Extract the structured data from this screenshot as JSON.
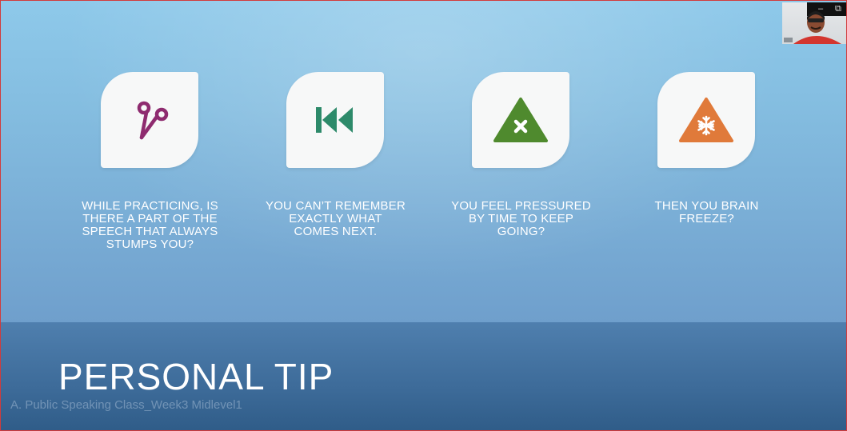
{
  "slide": {
    "title": "PERSONAL TIP",
    "watermark": "A. Public Speaking Class_Week3 Midlevel1"
  },
  "tips": [
    {
      "icon": "scissors-icon",
      "icon_color": "#8e2b6f",
      "text": "WHILE PRACTICING, IS\nTHERE A PART OF THE\nSPEECH THAT ALWAYS\nSTUMPS YOU?"
    },
    {
      "icon": "rewind-icon",
      "icon_color": "#2d8a6a",
      "text": "YOU CAN’T REMEMBER\nEXACTLY WHAT\nCOMES NEXT."
    },
    {
      "icon": "warning-x-icon",
      "icon_color": "#4f8a2e",
      "text": "YOU FEEL PRESSURED\nBY TIME TO KEEP\nGOING?"
    },
    {
      "icon": "warning-snowflake-icon",
      "icon_color": "#e07a3a",
      "text": "THEN YOU BRAIN\nFREEZE?"
    }
  ],
  "video_window": {
    "minimize_label": "–",
    "restore_label": "⧉"
  },
  "colors": {
    "border": "#d23b3b",
    "caption_text": "#ffffff",
    "tile_bg": "#f7f8f8"
  }
}
